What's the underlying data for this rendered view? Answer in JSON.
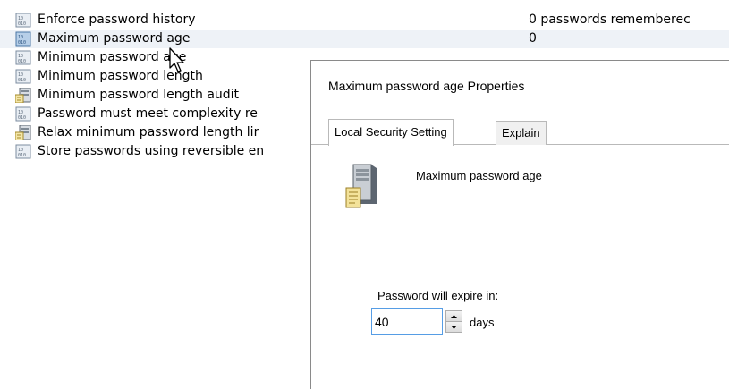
{
  "policies": [
    {
      "name": "Enforce password history",
      "value": "0 passwords rememberec",
      "icon": "policy-icon",
      "selected": false
    },
    {
      "name": "Maximum password age",
      "value": "0",
      "icon": "policy-icon",
      "selected": true
    },
    {
      "name": "Minimum password age",
      "value": "",
      "icon": "policy-icon",
      "selected": false
    },
    {
      "name": "Minimum password length",
      "value": "",
      "icon": "policy-icon",
      "selected": false
    },
    {
      "name": "Minimum password length audit",
      "value": "",
      "icon": "audit-policy-icon",
      "selected": false
    },
    {
      "name": "Password must meet complexity re",
      "value": "",
      "icon": "policy-icon",
      "selected": false
    },
    {
      "name": "Relax minimum password length lir",
      "value": "",
      "icon": "audit-policy-icon",
      "selected": false
    },
    {
      "name": "Store passwords using reversible en",
      "value": "",
      "icon": "policy-icon",
      "selected": false
    }
  ],
  "dialog": {
    "title": "Maximum password age Properties",
    "tabs": [
      "Local Security Setting",
      "Explain"
    ],
    "active_tab": "Local Security Setting",
    "setting_name": "Maximum password age",
    "expire_label": "Password will expire in:",
    "expire_value": "40",
    "unit_label": "days"
  },
  "colors": {
    "selected_row": "#eef2f7",
    "input_focus_border": "#569de5",
    "dialog_border": "#8a8a8a"
  }
}
